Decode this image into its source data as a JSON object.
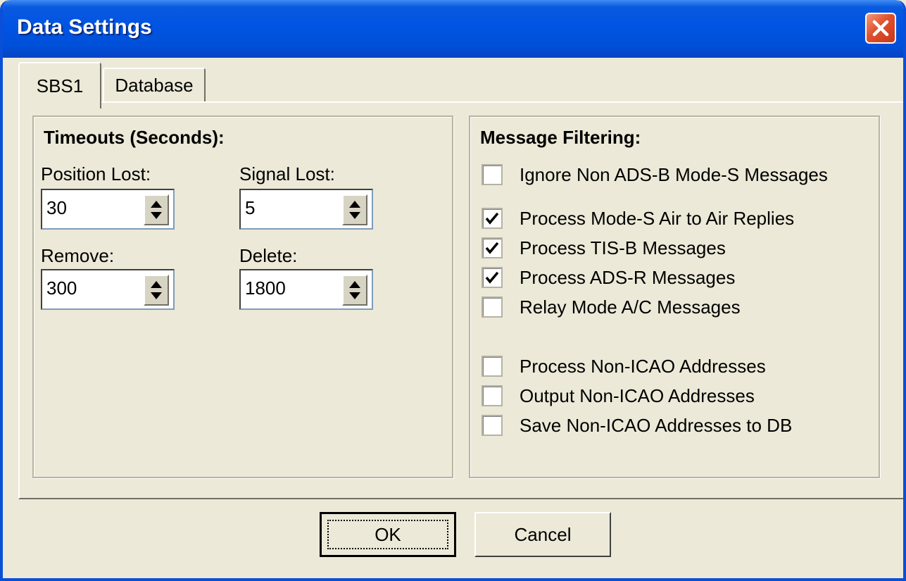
{
  "window": {
    "title": "Data Settings"
  },
  "tabs": [
    {
      "label": "SBS1",
      "active": true
    },
    {
      "label": "Database",
      "active": false
    }
  ],
  "timeouts": {
    "title": "Timeouts (Seconds):",
    "position_lost": {
      "label": "Position Lost:",
      "value": "30"
    },
    "signal_lost": {
      "label": "Signal Lost:",
      "value": "5"
    },
    "remove": {
      "label": "Remove:",
      "value": "300"
    },
    "delete": {
      "label": "Delete:",
      "value": "1800"
    }
  },
  "filtering": {
    "title": "Message Filtering:",
    "options": [
      {
        "label": "Ignore Non ADS-B Mode-S Messages",
        "checked": false
      },
      {
        "label": "Process Mode-S Air to Air Replies",
        "checked": true
      },
      {
        "label": "Process TIS-B Messages",
        "checked": true
      },
      {
        "label": "Process ADS-R Messages",
        "checked": true
      },
      {
        "label": "Relay Mode A/C Messages",
        "checked": false
      },
      {
        "label": "Process Non-ICAO Addresses",
        "checked": false
      },
      {
        "label": "Output Non-ICAO Addresses",
        "checked": false
      },
      {
        "label": "Save Non-ICAO Addresses to DB",
        "checked": false
      }
    ]
  },
  "buttons": {
    "ok": "OK",
    "cancel": "Cancel"
  },
  "icons": {
    "close": "close-icon",
    "spin": "spin-arrows-icon",
    "check": "checkmark-icon"
  },
  "colors": {
    "titlebar": "#0054e3",
    "close_button": "#e0502c",
    "face": "#ece9d8"
  }
}
